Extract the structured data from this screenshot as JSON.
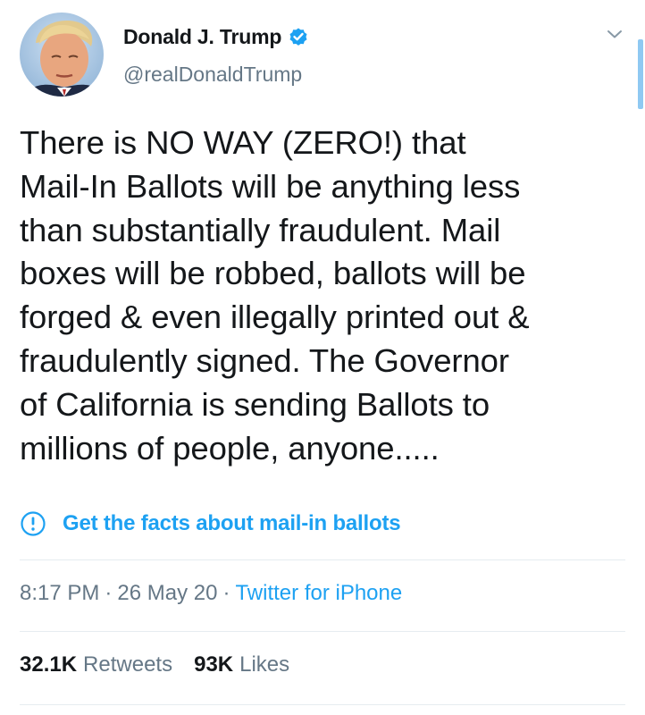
{
  "author": {
    "display_name": "Donald J. Trump",
    "handle": "@realDonaldTrump",
    "verified_icon": "verified-badge-icon",
    "avatar_icon": "avatar"
  },
  "tweet": {
    "text": "There is NO WAY (ZERO!) that\nMail-In Ballots will be anything less\nthan substantially fraudulent. Mail\nboxes will be robbed, ballots will be\nforged & even illegally printed out &\nfraudulently signed. The Governor\nof California is sending Ballots to\nmillions of people, anyone.....",
    "facts_link": "Get the facts about mail-in ballots",
    "time": "8:17 PM",
    "date": "26 May 20",
    "source": "Twitter for iPhone",
    "separator": "·"
  },
  "stats": {
    "retweets_count": "32.1K",
    "retweets_label": "Retweets",
    "likes_count": "93K",
    "likes_label": "Likes"
  },
  "colors": {
    "link_blue": "#1da1f2",
    "secondary_text": "#657786",
    "primary_text": "#14171a",
    "divider": "#e6ecf0"
  }
}
